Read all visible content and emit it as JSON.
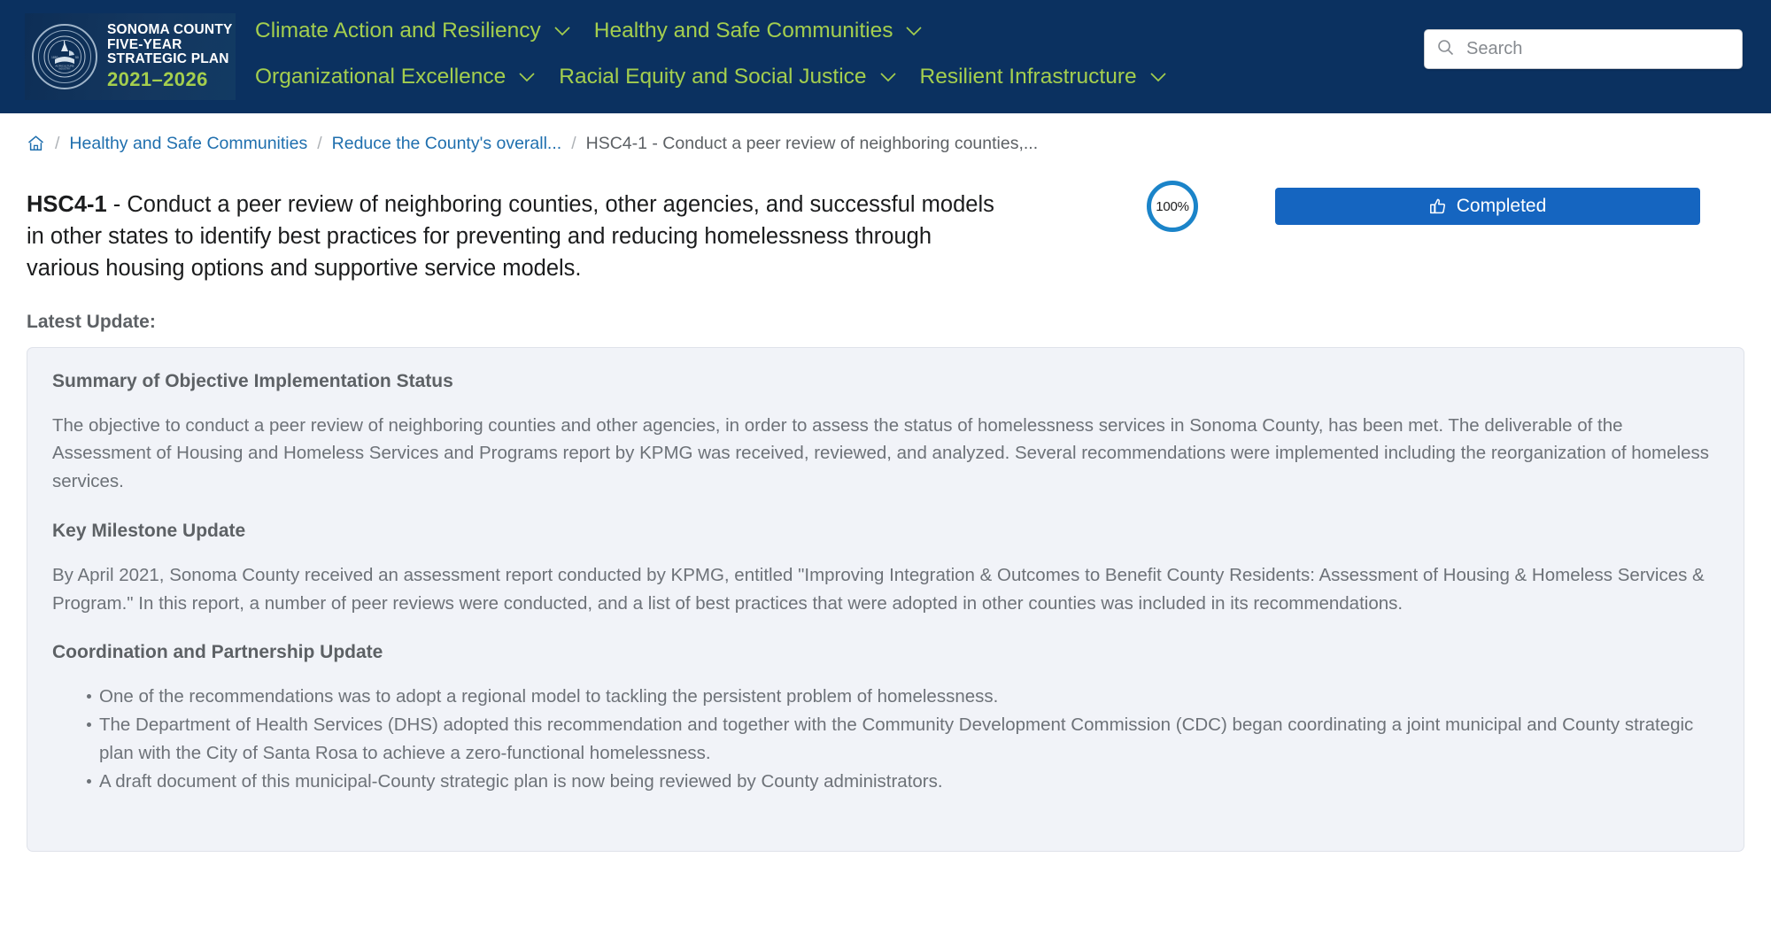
{
  "header": {
    "brand": {
      "line1": "SONOMA COUNTY",
      "line2": "FIVE-YEAR",
      "line3": "STRATEGIC PLAN",
      "years": "2021–2026",
      "seal_alt": "county-seal"
    },
    "nav": [
      {
        "label": "Climate Action and Resiliency",
        "icon": "chevron-down-icon"
      },
      {
        "label": "Healthy and Safe Communities",
        "icon": "chevron-down-icon"
      },
      {
        "label": "Organizational Excellence",
        "icon": "chevron-down-icon"
      },
      {
        "label": "Racial Equity and Social Justice",
        "icon": "chevron-down-icon"
      },
      {
        "label": "Resilient Infrastructure",
        "icon": "chevron-down-icon"
      }
    ],
    "search": {
      "placeholder": "Search",
      "value": "",
      "icon": "search-icon"
    },
    "colors": {
      "bar": "#0b3160",
      "nav_text": "#a4ce4e"
    }
  },
  "breadcrumb": {
    "home_icon": "home-icon",
    "separator": "/",
    "items": [
      {
        "label": "Healthy and Safe Communities",
        "type": "link"
      },
      {
        "label": "Reduce the County's overall...",
        "type": "link"
      },
      {
        "label": "HSC4-1 - Conduct a peer review of neighboring counties,...",
        "type": "current"
      }
    ]
  },
  "objective": {
    "code": "HSC4-1",
    "dash": " - ",
    "title": "Conduct a peer review of neighboring counties, other agencies, and successful models in other states to identify best practices for preventing and reducing homelessness through various housing options and supportive service models.",
    "progress_percent": "100%",
    "progress_value": 100,
    "status_button": {
      "label": "Completed",
      "icon": "thumbs-up-icon",
      "color": "#1565c0"
    },
    "progress_color": "#1b84c9"
  },
  "latest_update": {
    "label": "Latest Update:",
    "sections": [
      {
        "heading": "Summary of Objective Implementation Status",
        "paragraphs": [
          "The objective to conduct a peer review of neighboring counties and other agencies, in order to assess the status of homelessness services in Sonoma County, has been met.  The deliverable of the Assessment of Housing and Homeless Services and Programs report by KPMG was received, reviewed, and analyzed. Several recommendations were implemented including the reorganization of homeless services."
        ]
      },
      {
        "heading": "Key Milestone Update",
        "paragraphs": [
          "By April 2021, Sonoma County received an assessment report conducted by KPMG, entitled \"Improving Integration & Outcomes to Benefit County Residents: Assessment of Housing & Homeless Services & Program.\"  In this report, a number of peer reviews were conducted, and a list of best practices that were adopted in other counties was included in its recommendations."
        ]
      },
      {
        "heading": "Coordination and Partnership Update",
        "bullets": [
          "One of the recommendations was to adopt a regional model to tackling the persistent problem of homelessness.",
          "The Department of Health Services (DHS) adopted this recommendation and together with the Community Development Commission (CDC) began coordinating a joint municipal and County strategic plan with the City of Santa Rosa to achieve a zero-functional homelessness.",
          "A draft document of this municipal-County strategic plan is now being reviewed by County administrators."
        ]
      }
    ]
  }
}
